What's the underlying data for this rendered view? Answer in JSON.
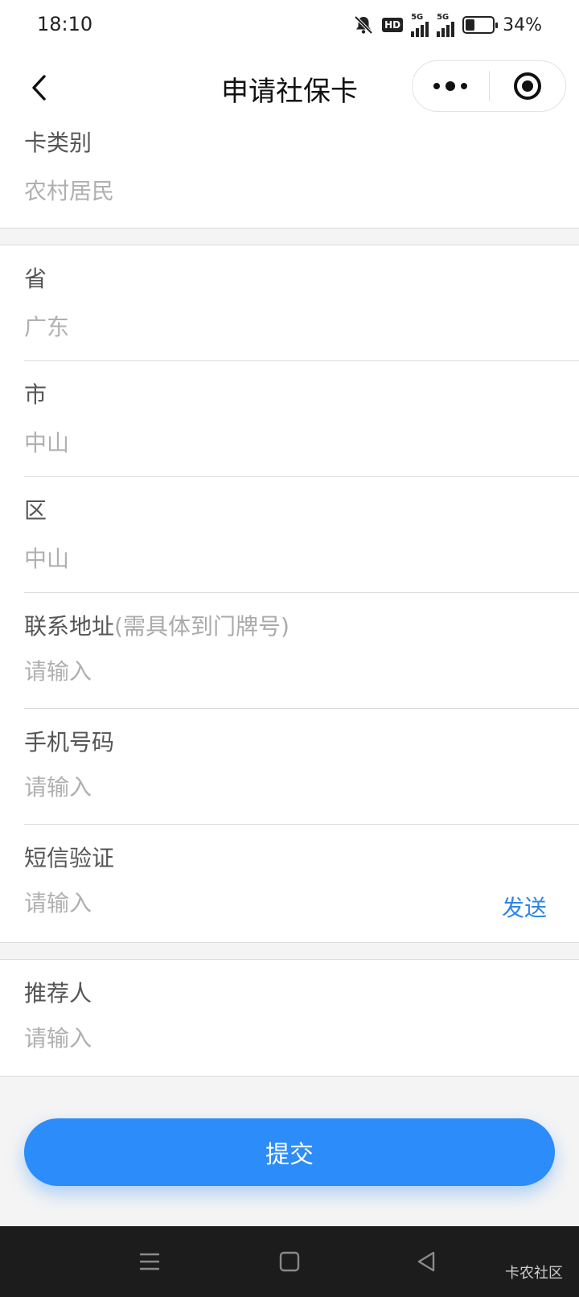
{
  "status_bar": {
    "time": "18:10",
    "hd_label": "HD",
    "signal1_label": "5G",
    "signal2_label": "5G",
    "battery_percent_text": "34%",
    "battery_level": 0.34
  },
  "header": {
    "title": "申请社保卡",
    "back_icon": "chevron-left-icon",
    "more_icon": "more-dots-icon",
    "close_icon": "target-icon"
  },
  "form": {
    "card_type": {
      "label": "卡类别",
      "value": "农村居民"
    },
    "province": {
      "label": "省",
      "value": "广东"
    },
    "city": {
      "label": "市",
      "value": "中山"
    },
    "district": {
      "label": "区",
      "value": "中山"
    },
    "address": {
      "label": "联系地址",
      "hint": "(需具体到门牌号)",
      "placeholder": "请输入"
    },
    "phone": {
      "label": "手机号码",
      "placeholder": "请输入"
    },
    "sms": {
      "label": "短信验证",
      "placeholder": "请输入",
      "send_label": "发送"
    },
    "referrer": {
      "label": "推荐人",
      "placeholder": "请输入"
    }
  },
  "submit_label": "提交",
  "watermark": "卡农社区",
  "colors": {
    "accent": "#2b8cfa",
    "link": "#2e86e8",
    "background": "#f4f4f4"
  }
}
